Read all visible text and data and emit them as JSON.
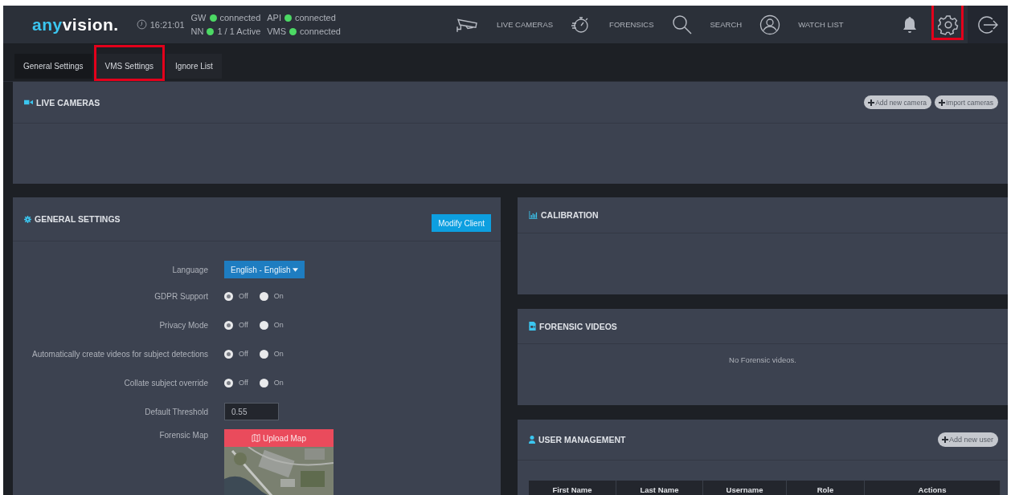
{
  "header": {
    "logo": {
      "accent": "any",
      "rest": "vision."
    },
    "time": "16:21:01",
    "status": [
      {
        "key": "GW",
        "value": "connected",
        "color": "#4cd964"
      },
      {
        "key": "API",
        "value": "connected",
        "color": "#4cd964"
      },
      {
        "key": "NN",
        "value": "1 / 1 Active",
        "color": "#4cd964"
      },
      {
        "key": "VMS",
        "value": "connected",
        "color": "#4cd964"
      }
    ],
    "nav": [
      {
        "label": "LIVE CAMERAS",
        "kind": "cctv"
      },
      {
        "label": "FORENSICS",
        "kind": "stopwatch"
      },
      {
        "label": "SEARCH",
        "kind": "search"
      },
      {
        "label": "WATCH LIST",
        "kind": "person"
      }
    ],
    "actions": [
      {
        "kind": "bell",
        "highlighted": false
      },
      {
        "kind": "settings",
        "highlighted": true
      },
      {
        "kind": "logout",
        "highlighted": false
      }
    ]
  },
  "tabs": [
    {
      "label": "General Settings",
      "selected": true,
      "highlighted": false
    },
    {
      "label": "VMS Settings",
      "selected": false,
      "highlighted": true
    },
    {
      "label": "Ignore List",
      "selected": false,
      "highlighted": false
    }
  ],
  "live_cameras": {
    "title": "LIVE CAMERAS",
    "buttons": [
      "Add new camera",
      "Import cameras"
    ]
  },
  "general_settings": {
    "title": "GENERAL SETTINGS",
    "button": "Modify Client",
    "rows": [
      {
        "kind": "dropdown",
        "label": "Language",
        "value": "English - English"
      },
      {
        "kind": "radio",
        "label": "GDPR Support",
        "options": [
          {
            "label": "Off",
            "selected": true
          },
          {
            "label": "On",
            "selected": false
          }
        ]
      },
      {
        "kind": "radio",
        "label": "Privacy Mode",
        "options": [
          {
            "label": "Off",
            "selected": true
          },
          {
            "label": "On",
            "selected": false
          }
        ]
      },
      {
        "kind": "radio",
        "label": "Automatically create videos for subject detections",
        "options": [
          {
            "label": "Off",
            "selected": true
          },
          {
            "label": "On",
            "selected": false
          }
        ]
      },
      {
        "kind": "radio",
        "label": "Collate subject override",
        "options": [
          {
            "label": "Off",
            "selected": true
          },
          {
            "label": "On",
            "selected": false
          }
        ]
      },
      {
        "kind": "input",
        "label": "Default Threshold",
        "value": "0.55"
      },
      {
        "kind": "map",
        "label": "Forensic Map",
        "button": "Upload Map"
      }
    ]
  },
  "calibration": {
    "title": "CALIBRATION"
  },
  "forensic_videos": {
    "title": "FORENSIC VIDEOS",
    "empty_text": "No Forensic videos."
  },
  "user_management": {
    "title": "USER MANAGEMENT",
    "button": "Add new user",
    "columns": [
      "First Name",
      "Last Name",
      "Username",
      "Role",
      "Actions"
    ]
  }
}
